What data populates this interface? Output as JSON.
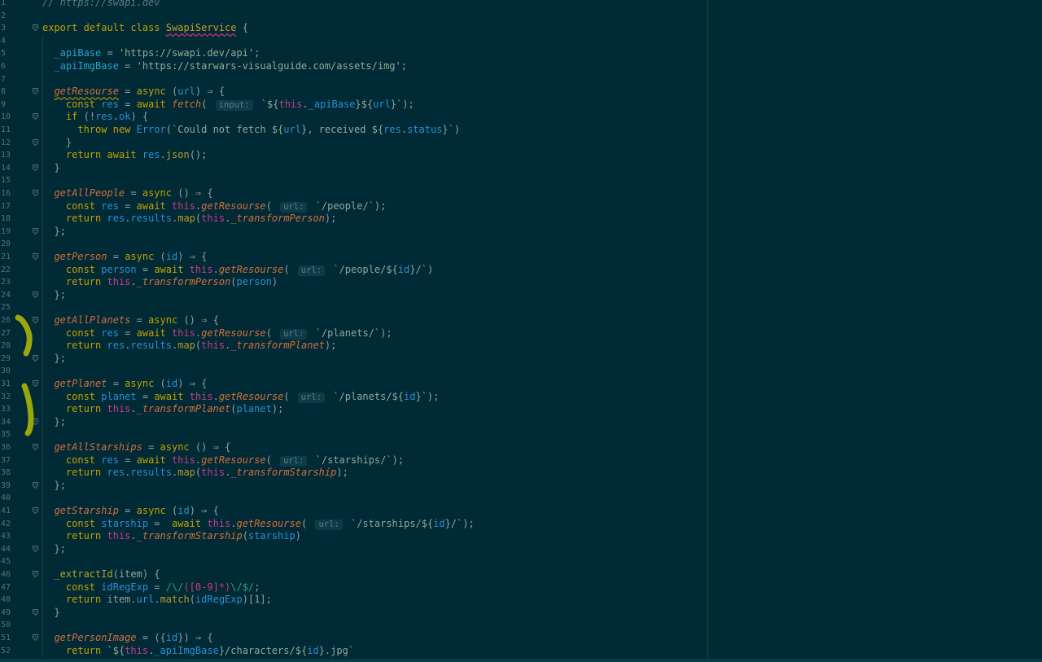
{
  "editor": {
    "language": "JavaScript",
    "colors": {
      "background": "#002a35",
      "keyword": "#c4a000",
      "function": "#d26f3d",
      "string": "#97a995",
      "variable": "#2b8fd1",
      "this": "#c83b8c",
      "highlighter_marks": "#9aa60d"
    },
    "lines": [
      {
        "n": "1",
        "text": "// https://swapi.dev"
      },
      {
        "n": "2",
        "text": ""
      },
      {
        "n": "3",
        "text": "export default class SwapiService {"
      },
      {
        "n": "4",
        "text": ""
      },
      {
        "n": "5",
        "text": "  _apiBase = 'https://swapi.dev/api';"
      },
      {
        "n": "6",
        "text": "  _apiImgBase = 'https://starwars-visualguide.com/assets/img';"
      },
      {
        "n": "7",
        "text": ""
      },
      {
        "n": "8",
        "text": "  getResourse = async (url) ⇒ {"
      },
      {
        "n": "9",
        "text": "    const res = await fetch( input: `${this._apiBase}${url}`);"
      },
      {
        "n": "10",
        "text": "    if (!res.ok) {"
      },
      {
        "n": "11",
        "text": "      throw new Error(`Could not fetch ${url}, received ${res.status}`)"
      },
      {
        "n": "12",
        "text": "    }"
      },
      {
        "n": "13",
        "text": "    return await res.json();"
      },
      {
        "n": "14",
        "text": "  }"
      },
      {
        "n": "15",
        "text": ""
      },
      {
        "n": "16",
        "text": "  getAllPeople = async () ⇒ {"
      },
      {
        "n": "17",
        "text": "    const res = await this.getResourse( url: `/people/`);"
      },
      {
        "n": "18",
        "text": "    return res.results.map(this._transformPerson);"
      },
      {
        "n": "19",
        "text": "  };"
      },
      {
        "n": "20",
        "text": ""
      },
      {
        "n": "21",
        "text": "  getPerson = async (id) ⇒ {"
      },
      {
        "n": "22",
        "text": "    const person = await this.getResourse( url: `/people/${id}/`)"
      },
      {
        "n": "23",
        "text": "    return this._transformPerson(person)"
      },
      {
        "n": "24",
        "text": "  };"
      },
      {
        "n": "25",
        "text": ""
      },
      {
        "n": "26",
        "text": "  getAllPlanets = async () ⇒ {"
      },
      {
        "n": "27",
        "text": "    const res = await this.getResourse( url: `/planets/`);"
      },
      {
        "n": "28",
        "text": "    return res.results.map(this._transformPlanet);"
      },
      {
        "n": "29",
        "text": "  };"
      },
      {
        "n": "30",
        "text": ""
      },
      {
        "n": "31",
        "text": "  getPlanet = async (id) ⇒ {"
      },
      {
        "n": "32",
        "text": "    const planet = await this.getResourse( url: `/planets/${id}`);"
      },
      {
        "n": "33",
        "text": "    return this._transformPlanet(planet);"
      },
      {
        "n": "34",
        "text": "  };"
      },
      {
        "n": "35",
        "text": ""
      },
      {
        "n": "36",
        "text": "  getAllStarships = async () ⇒ {"
      },
      {
        "n": "37",
        "text": "    const res = await this.getResourse( url: `/starships/`);"
      },
      {
        "n": "38",
        "text": "    return res.results.map(this._transformStarship);"
      },
      {
        "n": "39",
        "text": "  };"
      },
      {
        "n": "40",
        "text": ""
      },
      {
        "n": "41",
        "text": "  getStarship = async (id) ⇒ {"
      },
      {
        "n": "42",
        "text": "    const starship =  await this.getResourse( url: `/starships/${id}/`);"
      },
      {
        "n": "43",
        "text": "    return this._transformStarship(starship)"
      },
      {
        "n": "44",
        "text": "  };"
      },
      {
        "n": "45",
        "text": ""
      },
      {
        "n": "46",
        "text": "  _extractId(item) {"
      },
      {
        "n": "47",
        "text": "    const idRegExp = /\\/([0-9]*)\\/$/;"
      },
      {
        "n": "48",
        "text": "    return item.url.match(idRegExp)[1];"
      },
      {
        "n": "49",
        "text": "  }"
      },
      {
        "n": "50",
        "text": ""
      },
      {
        "n": "51",
        "text": "  getPersonImage = ({id}) ⇒ {"
      },
      {
        "n": "52",
        "text": "    return `${this._apiImgBase}/characters/${id}.jpg`"
      }
    ]
  }
}
